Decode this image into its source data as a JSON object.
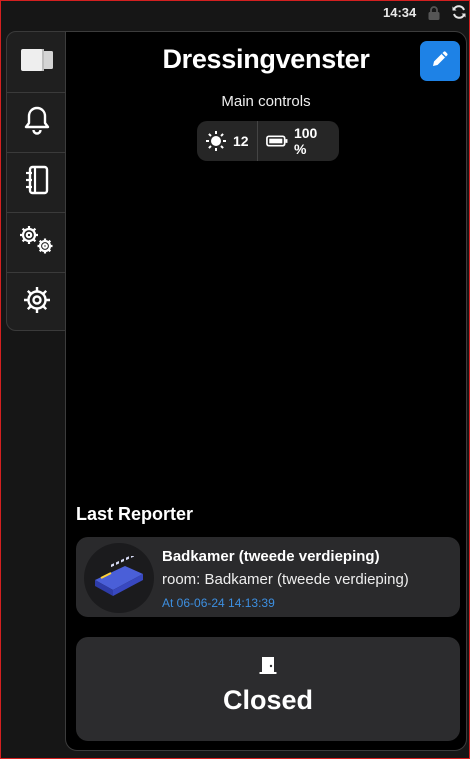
{
  "status_bar": {
    "time": "14:34",
    "lock_icon": "lock-icon",
    "sync_icon": "sync-icon"
  },
  "sidebar": {
    "items": [
      {
        "name": "device",
        "icon": "device-icon"
      },
      {
        "name": "notifications",
        "icon": "bell-icon"
      },
      {
        "name": "log",
        "icon": "notebook-icon"
      },
      {
        "name": "automations",
        "icon": "gears-icon"
      },
      {
        "name": "settings",
        "icon": "gear-icon"
      }
    ]
  },
  "header": {
    "title": "Dressingvenster",
    "edit_icon": "pencil-icon",
    "subtitle": "Main controls"
  },
  "indicators": {
    "brightness": "12",
    "battery": "100 %"
  },
  "last_reporter": {
    "heading": "Last Reporter",
    "name": "Badkamer (tweede verdieping)",
    "room": "room: Badkamer (tweede verdieping)",
    "timestamp": "At 06-06-24 14:13:39"
  },
  "state": {
    "icon": "door-icon",
    "label": "Closed"
  },
  "colors": {
    "accent": "#1e82e6",
    "timestamp": "#3d8fe0",
    "card": "#2a2a2c",
    "panel": "#000000"
  }
}
